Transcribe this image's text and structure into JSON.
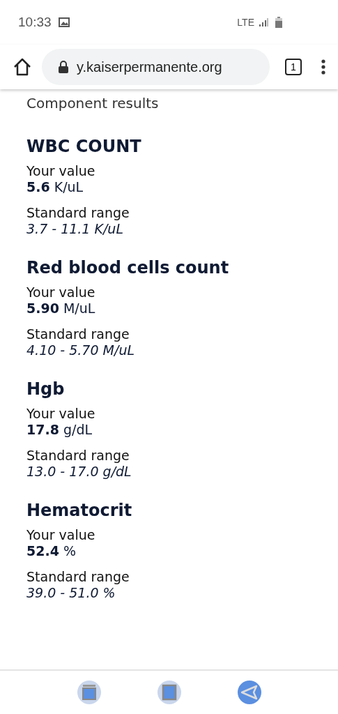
{
  "status_bar": {
    "time": "10:33",
    "network": "LTE"
  },
  "browser": {
    "url": "y.kaiserpermanente.org",
    "tab_count": "1"
  },
  "page": {
    "heading": "Component results",
    "results": [
      {
        "name": "WBC COUNT",
        "value_label": "Your value",
        "value": "**5.6** K/uL",
        "range_label": "Standard range",
        "range": "3.7 - 11.1 K/uL"
      },
      {
        "name": "Red blood cells count",
        "value_label": "Your value",
        "value": "**5.90** M/uL",
        "range_label": "Standard range",
        "range": "4.10 - 5.70 M/uL"
      },
      {
        "name": "Hgb",
        "value_label": "Your value",
        "value": "**17.8** g/dL",
        "range_label": "Standard range",
        "range": "13.0 - 17.0 g/dL"
      },
      {
        "name": "Hematocrit",
        "value_label": "Your value",
        "value": "**52.4** %",
        "range_label": "Standard range",
        "range": "39.0 - 51.0 %"
      }
    ]
  }
}
